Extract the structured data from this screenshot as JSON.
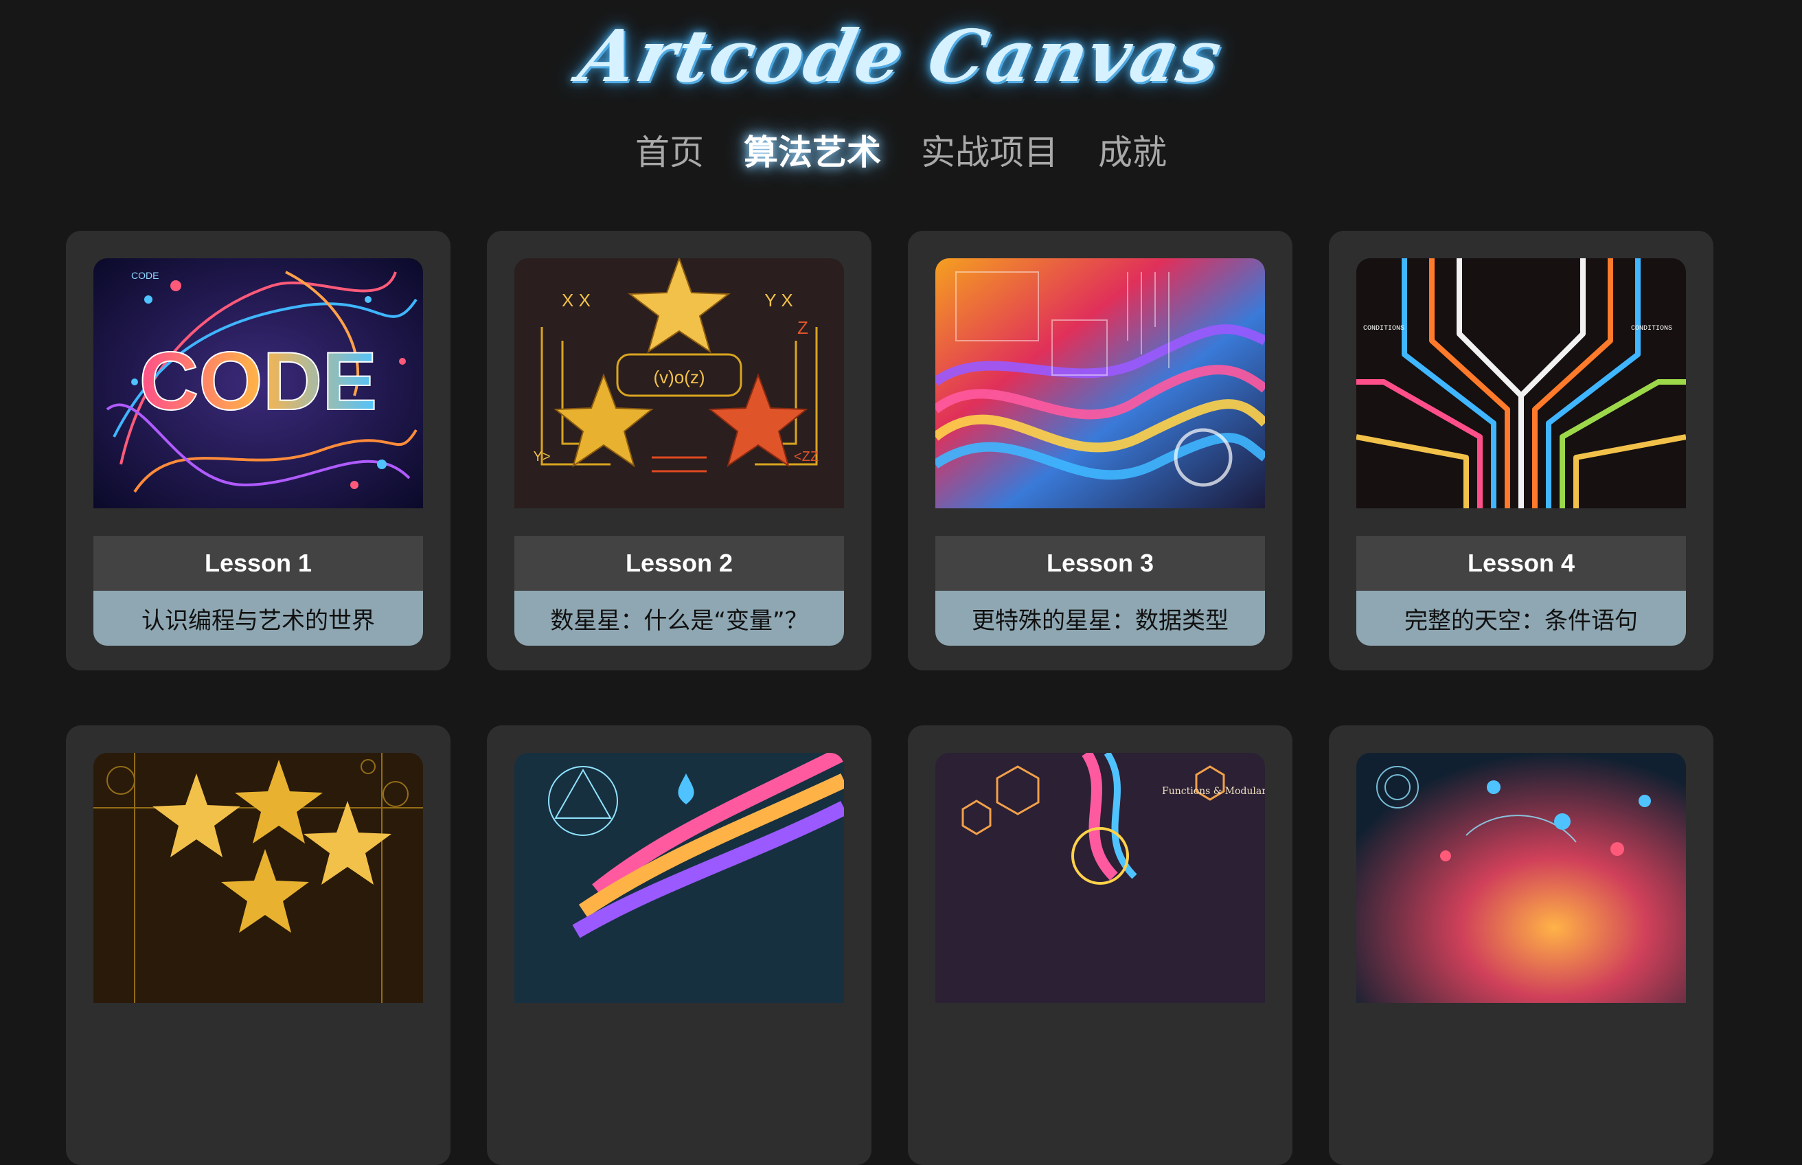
{
  "site": {
    "title": "Artcode Canvas"
  },
  "nav": {
    "items": [
      {
        "label": "首页"
      },
      {
        "label": "算法艺术",
        "active": true
      },
      {
        "label": "实战项目"
      },
      {
        "label": "成就"
      }
    ]
  },
  "lessons": [
    {
      "label": "Lesson 1",
      "title": "认识编程与艺术的世界",
      "image": "code-swirl-art"
    },
    {
      "label": "Lesson 2",
      "title": "数星星：什么是“变量”？",
      "image": "golden-stars-art"
    },
    {
      "label": "Lesson 3",
      "title": "更特殊的星星：数据类型",
      "image": "color-wave-art"
    },
    {
      "label": "Lesson 4",
      "title": "完整的天空：条件语句",
      "image": "circuit-tree-art"
    },
    {
      "label": "",
      "title": "",
      "image": "gold-stars-art"
    },
    {
      "label": "",
      "title": "",
      "image": "rainbow-flow-art"
    },
    {
      "label": "",
      "title": "",
      "image": "functions-modularity-art"
    },
    {
      "label": "",
      "title": "",
      "image": "cosmic-swirl-art"
    }
  ],
  "art_text": {
    "lesson1_word": "CODE",
    "lesson1_corner": "CODE",
    "lesson2_formula": "(v)o(z)",
    "lesson2_x": "X X",
    "lesson2_y": "Y X",
    "lesson2_z": "Z",
    "lesson2_yl": "Y>",
    "lesson2_zz": "<ZZ",
    "lesson4_left": "CONDITIONS",
    "lesson4_right": "CONDITIONS",
    "lesson7_caption": "Functions & Modularity"
  },
  "colors": {
    "background": "#171717",
    "card": "#2e2e2e",
    "lesson_bar": "#434343",
    "title_bar": "#8ea7b2",
    "logo_glow": "#4fb4f0"
  }
}
